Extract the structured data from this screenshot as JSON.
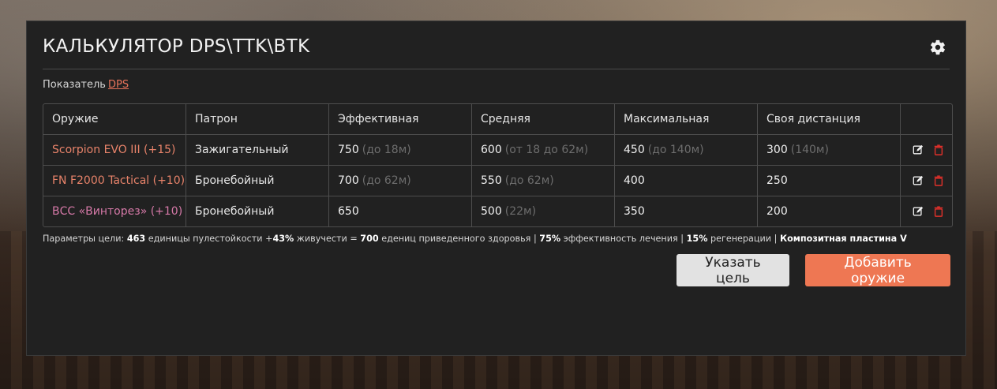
{
  "header": {
    "title": "КАЛЬКУЛЯТОР DPS\\TTK\\BTK",
    "settings_icon": "gear-icon"
  },
  "indicator": {
    "label": "Показатель",
    "value": "DPS"
  },
  "table": {
    "columns": [
      "Оружие",
      "Патрон",
      "Эффективная",
      "Средняя",
      "Максимальная",
      "Своя дистанция",
      ""
    ],
    "rows": [
      {
        "weapon": "Scorpion EVO III (+15)",
        "weapon_color": "#e8836a",
        "ammo": "Зажигательный",
        "effective": {
          "value": "750",
          "note": "(до 18м)"
        },
        "average": {
          "value": "600",
          "note": "(от 18 до 62м)"
        },
        "maximum": {
          "value": "450",
          "note": "(до 140м)"
        },
        "custom": {
          "value": "300",
          "note": "(140м)"
        }
      },
      {
        "weapon": "FN F2000 Tactical (+10)",
        "weapon_color": "#e8836a",
        "ammo": "Бронебойный",
        "effective": {
          "value": "700",
          "note": "(до 62м)"
        },
        "average": {
          "value": "550",
          "note": "(до 62м)"
        },
        "maximum": {
          "value": "400",
          "note": ""
        },
        "custom": {
          "value": "250",
          "note": ""
        }
      },
      {
        "weapon": "ВСС «Винторез» (+10)",
        "weapon_color": "#d679a8",
        "ammo": "Бронебойный",
        "effective": {
          "value": "650",
          "note": ""
        },
        "average": {
          "value": "500",
          "note": "(22м)"
        },
        "maximum": {
          "value": "350",
          "note": ""
        },
        "custom": {
          "value": "200",
          "note": ""
        }
      }
    ],
    "edit_icon": "edit-icon",
    "delete_icon": "trash-icon"
  },
  "params": {
    "prefix": "Параметры цели:",
    "hp_value": "463",
    "hp_text": "единицы пулестойкости",
    "vit_prefix": "+",
    "vit_value": "43%",
    "vit_text": "живучести =",
    "total_value": "700",
    "total_text": "едениц приведенного здоровья |",
    "heal_value": "75%",
    "heal_text": "эффективность лечения |",
    "regen_value": "15%",
    "regen_text": "регенерации |",
    "armor": "Композитная пластина V"
  },
  "buttons": {
    "target": "Указать цель",
    "add": "Добавить оружие"
  },
  "colors": {
    "accent": "#ee7753",
    "panel": "#212121",
    "delete": "#e0302a"
  }
}
